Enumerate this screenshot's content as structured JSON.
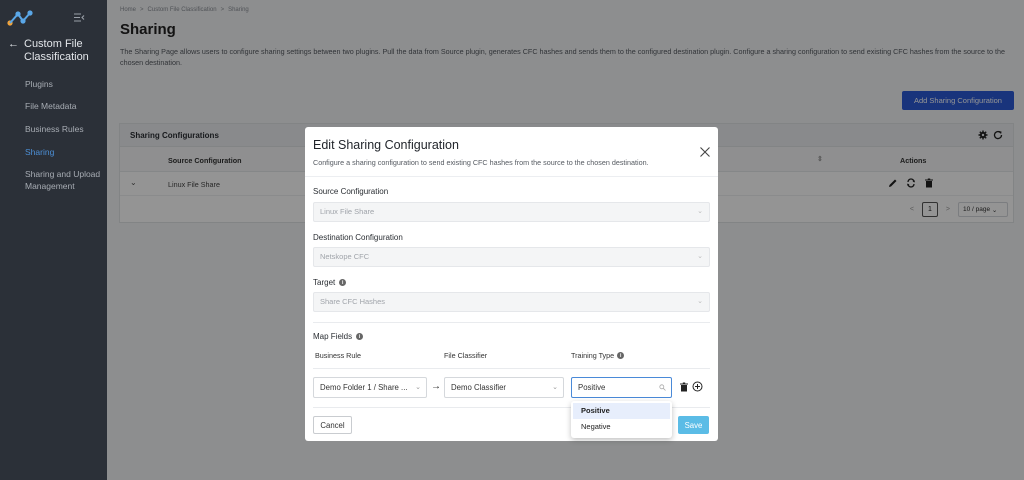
{
  "sidebar": {
    "back_label": "Custom File Classification",
    "items": [
      {
        "label": "Plugins"
      },
      {
        "label": "File Metadata"
      },
      {
        "label": "Business Rules"
      },
      {
        "label": "Sharing"
      },
      {
        "label": "Sharing and Upload Management"
      }
    ],
    "active_item": "Sharing"
  },
  "breadcrumb": {
    "home": "Home",
    "sep": ">",
    "parent": "Custom File Classification",
    "current": "Sharing"
  },
  "page": {
    "title": "Sharing",
    "description": "The Sharing Page allows users to configure sharing settings between two plugins. Pull the data from Source plugin, generates CFC hashes and sends them to the configured destination plugin. Configure a sharing configuration to send existing CFC hashes from the source to the chosen destination.",
    "add_button": "Add Sharing Configuration"
  },
  "panel": {
    "title": "Sharing Configurations",
    "columns": {
      "source": "Source Configuration",
      "actions": "Actions"
    },
    "rows": [
      {
        "source": "Linux File Share"
      }
    ],
    "pagination": {
      "prev": "<",
      "page": "1",
      "next": ">",
      "page_size": "10 / page"
    }
  },
  "modal": {
    "title": "Edit Sharing Configuration",
    "subtitle": "Configure a sharing configuration to send existing CFC hashes from the source to the chosen destination.",
    "source_label": "Source Configuration",
    "source_value": "Linux File Share",
    "destination_label": "Destination Configuration",
    "destination_value": "Netskope CFC",
    "target_label": "Target",
    "target_value": "Share CFC Hashes",
    "map_fields_label": "Map Fields",
    "columns": {
      "business_rule": "Business Rule",
      "file_classifier": "File Classifier",
      "training_type": "Training Type"
    },
    "mapping": {
      "business_rule": "Demo Folder 1 / Share ...",
      "file_classifier": "Demo Classifier",
      "training_type": "Positive"
    },
    "cancel_label": "Cancel",
    "save_label": "Save"
  },
  "dropdown": {
    "options": [
      "Positive",
      "Negative"
    ],
    "selected": "Positive"
  },
  "colors": {
    "sidebar_bg": "#2b3038",
    "active_nav": "#4c8fd6",
    "primary_button": "#2c5bd6",
    "save_button": "#5bbce6"
  },
  "icons": [
    "logo-icon",
    "collapse-sidebar-icon",
    "back-arrow-icon",
    "settings-icon",
    "refresh-icon",
    "edit-icon",
    "sync-icon",
    "delete-icon",
    "close-icon",
    "info-icon",
    "arrow-right-icon",
    "search-icon",
    "trash-icon",
    "add-circle-icon",
    "chevron-down-icon"
  ]
}
